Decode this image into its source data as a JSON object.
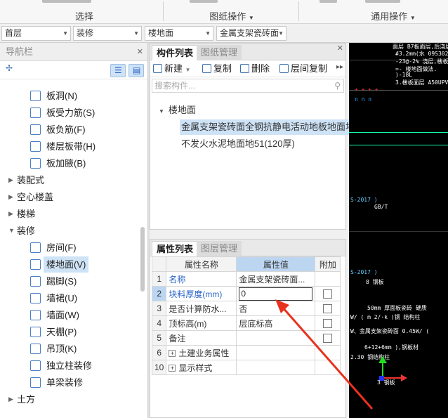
{
  "ribbon": {
    "groups": [
      {
        "caption": "选择"
      },
      {
        "caption": "图纸操作",
        "dropdown": true
      },
      {
        "caption": "通用操作",
        "dropdown": true
      }
    ]
  },
  "selectors": [
    {
      "value": "首层"
    },
    {
      "value": "装修"
    },
    {
      "value": "楼地面"
    },
    {
      "value": "金属支架瓷砖面"
    }
  ],
  "nav": {
    "title": "导航栏",
    "items": [
      {
        "label": "板洞(N)",
        "icon": "slab-hole-icon",
        "level": 2
      },
      {
        "label": "板受力筋(S)",
        "icon": "slab-rebar-icon",
        "level": 2
      },
      {
        "label": "板负筋(F)",
        "icon": "negative-rebar-icon",
        "level": 2
      },
      {
        "label": "楼层板带(H)",
        "icon": "slab-strip-icon",
        "level": 2
      },
      {
        "label": "板加腋(B)",
        "icon": "slab-haunch-icon",
        "level": 2
      },
      {
        "label": "装配式",
        "level": 1,
        "expanded": false
      },
      {
        "label": "空心楼盖",
        "level": 1,
        "expanded": false
      },
      {
        "label": "楼梯",
        "level": 1,
        "expanded": false
      },
      {
        "label": "装修",
        "level": 1,
        "expanded": true
      },
      {
        "label": "房间(F)",
        "icon": "room-icon",
        "level": 2
      },
      {
        "label": "楼地面(V)",
        "icon": "floor-icon",
        "level": 2,
        "selected": true
      },
      {
        "label": "踢脚(S)",
        "icon": "skirting-icon",
        "level": 2
      },
      {
        "label": "墙裙(U)",
        "icon": "dado-icon",
        "level": 2
      },
      {
        "label": "墙面(W)",
        "icon": "wall-finish-icon",
        "level": 2
      },
      {
        "label": "天棚(P)",
        "icon": "ceiling-icon",
        "level": 2
      },
      {
        "label": "吊顶(K)",
        "icon": "suspended-ceiling-icon",
        "level": 2
      },
      {
        "label": "独立柱装修",
        "icon": "column-finish-icon",
        "level": 2
      },
      {
        "label": "单梁装修",
        "icon": "beam-finish-icon",
        "level": 2
      },
      {
        "label": "土方",
        "level": 1,
        "expanded": false
      }
    ]
  },
  "component_panel": {
    "tabs": [
      "构件列表",
      "图纸管理"
    ],
    "toolbar": {
      "new": "新建",
      "copy": "复制",
      "delete": "删除",
      "floor_copy": "层间复制"
    },
    "search_placeholder": "搜索构件...",
    "tree_root": "楼地面",
    "items": [
      "金属支架瓷砖面全钢抗静电活动地板地面地",
      "不发火水泥地面地51(120厚)"
    ]
  },
  "property_panel": {
    "tabs": [
      "属性列表",
      "图层管理"
    ],
    "headers": {
      "name": "属性名称",
      "value": "属性值",
      "attach": "附加"
    },
    "rows": [
      {
        "num": "1",
        "name": "名称",
        "value": "金属支架瓷砖面...",
        "blue": true,
        "checkbox": false
      },
      {
        "num": "2",
        "name": "块料厚度(mm)",
        "value": "0",
        "blue": true,
        "checkbox": true,
        "editing": true
      },
      {
        "num": "3",
        "name": "是否计算防水...",
        "value": "否",
        "checkbox": true
      },
      {
        "num": "4",
        "name": "顶标高(m)",
        "value": "层底标高",
        "checkbox": true
      },
      {
        "num": "5",
        "name": "备注",
        "value": "",
        "checkbox": true
      },
      {
        "num": "6",
        "name": "土建业务属性",
        "value": "",
        "expandable": true
      },
      {
        "num": "10",
        "name": "显示样式",
        "value": "",
        "expandable": true
      }
    ]
  },
  "colors": {
    "accent": "#2a64c8",
    "selection": "#cfe3f7",
    "arrow": "#e8321e",
    "cad_bg": "#000000"
  }
}
